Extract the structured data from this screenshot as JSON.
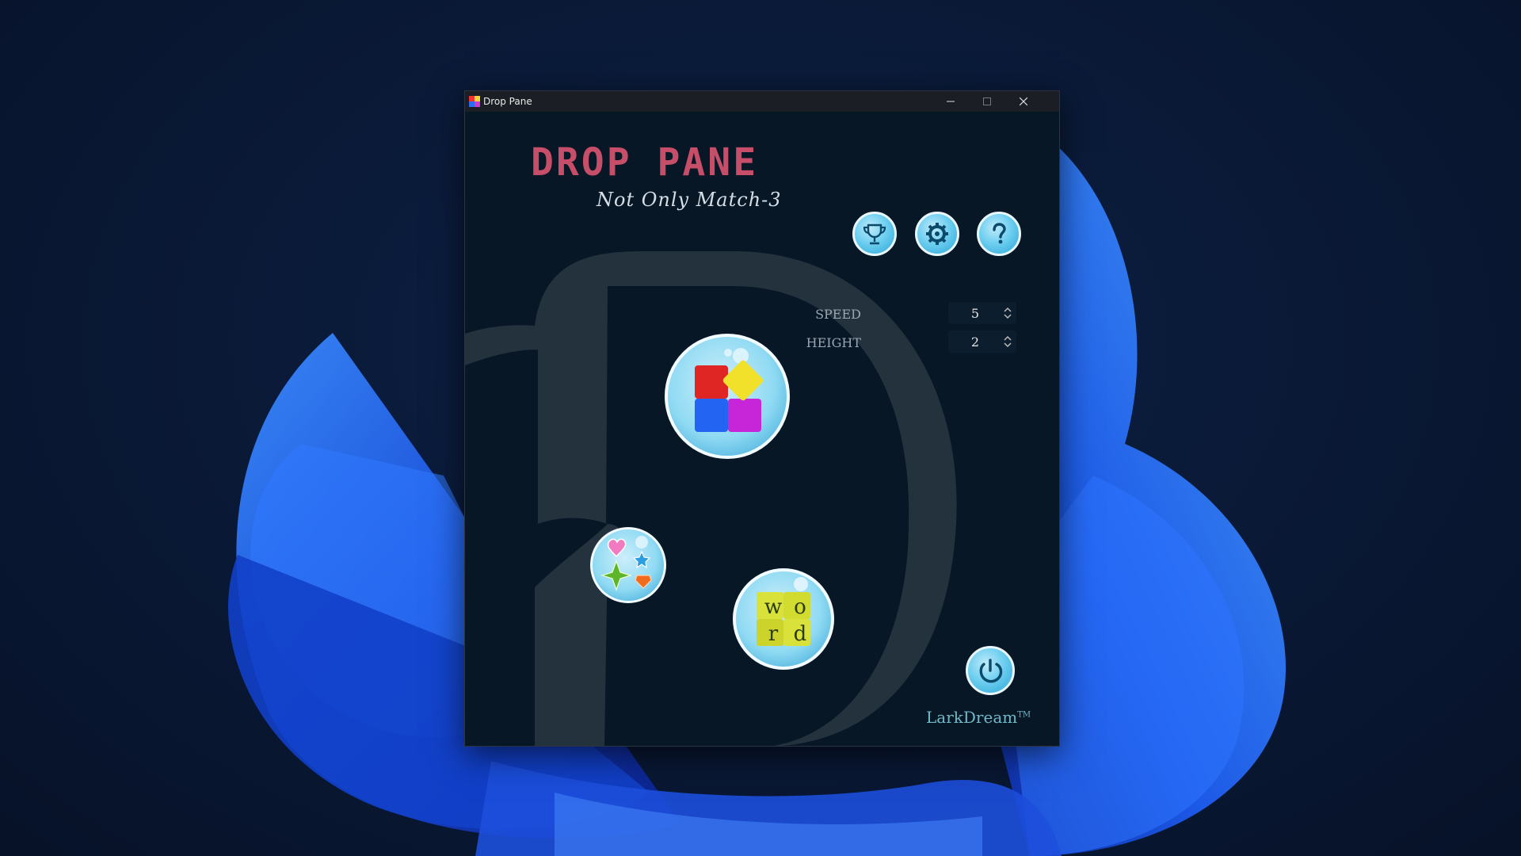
{
  "window": {
    "title": "Drop Pane",
    "controls": [
      "minimize",
      "maximize",
      "close"
    ]
  },
  "logo": {
    "title": "DROP PANE",
    "subtitle": "Not Only Match-3"
  },
  "toolbar": {
    "icons": [
      "trophy-icon",
      "gear-icon",
      "question-icon"
    ]
  },
  "options": {
    "speed": {
      "label": "SPEED",
      "value": "5"
    },
    "height": {
      "label": "HEIGHT",
      "value": "2"
    }
  },
  "games": {
    "match3": {
      "icon": "colored-blocks-icon"
    },
    "gems": {
      "icon": "gems-icon"
    },
    "word": {
      "icon": "word-tiles-icon",
      "tiles": [
        "w",
        "o",
        "r",
        "d"
      ]
    }
  },
  "footer": {
    "brand": "LarkDream",
    "trademark": "TM",
    "power_icon": "power-icon"
  },
  "colors": {
    "accent_title": "#c74e68",
    "bubble_blue": "#5cc8ee",
    "background": "#081726"
  }
}
